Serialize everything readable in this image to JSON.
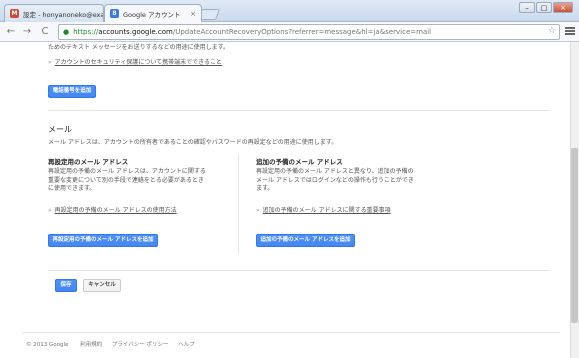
{
  "browser": {
    "tabs": [
      {
        "label": "設定 - honyanoneko@exa",
        "icon_text": "M",
        "color": "#d14836"
      },
      {
        "label": "Google アカウント",
        "icon_text": "8",
        "color": "#3b78e7"
      }
    ],
    "window_buttons": [
      "–",
      "□",
      "×"
    ],
    "nav": {
      "back": "←",
      "forward": "→",
      "reload": "C"
    },
    "url": {
      "scheme": "https://",
      "host": "accounts.google.com",
      "path": "/UpdateAccountRecoveryOptions?referrer=message&hl=ja&service=mail"
    },
    "star": "☆"
  },
  "phone": {
    "top_text": "ためのテキスト メッセージをお送りするなどの用途に使用します。",
    "security_link": "アカウントのセキュリティ保護について携帯端末でできること",
    "add_phone_button": "電話番号を追加"
  },
  "email": {
    "heading": "メール",
    "description": "メール アドレスは、アカウントの所有者であることの確認やパスワードの再設定などの用途に使用します。",
    "recovery": {
      "title": "再設定用のメール アドレス",
      "body": [
        "再設定用の予備のメール アドレスは、アカウントに関する",
        "重要な変更について別の手段で連絡をとる必要があるとき",
        "に使用できます。"
      ],
      "link": "再設定用の予備のメール アドレスの使用方法",
      "button": "再設定用の予備のメール アドレスを追加"
    },
    "additional": {
      "title": "追加の予備のメール アドレス",
      "body": [
        "再設定用の予備のメール アドレスと異なり、追加の予備の",
        "メール アドレスではログインなどの操作も行うことができ",
        "ます。"
      ],
      "link": "追加の予備のメール アドレスに関する重要事項",
      "button": "追加の予備のメール アドレスを追加"
    }
  },
  "actions": {
    "save": "保存",
    "cancel": "キャンセル"
  },
  "footer": {
    "copyright": "© 2013 Google",
    "terms": "利用規約",
    "privacy": "プライバシー ポリシー",
    "help": "ヘルプ"
  }
}
